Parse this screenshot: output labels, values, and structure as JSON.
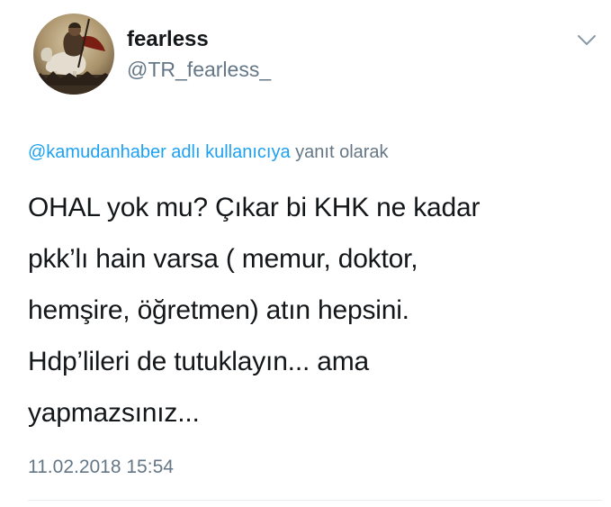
{
  "author": {
    "display_name": "fearless",
    "handle": "@TR_fearless_",
    "avatar_icon": "warrior-on-horse-avatar"
  },
  "reply_context": {
    "mention": "@kamudanhaber adlı kullanıcıya",
    "suffix": " yanıt olarak"
  },
  "tweet": {
    "lines": [
      "OHAL yok mu? Çıkar bi KHK ne kadar",
      "pkk’lı hain varsa ( memur, doktor,",
      "hemşire, öğretmen) atın hepsini.",
      "Hdp’lileri de tutuklayın... ama",
      "yapmazsınız..."
    ],
    "timestamp": "11.02.2018 15:54"
  },
  "menu": {
    "icon": "chevron-down-icon"
  },
  "colors": {
    "text": "#14171a",
    "secondary": "#657786",
    "link": "#1da1f2",
    "divider": "#e6ecf0"
  }
}
